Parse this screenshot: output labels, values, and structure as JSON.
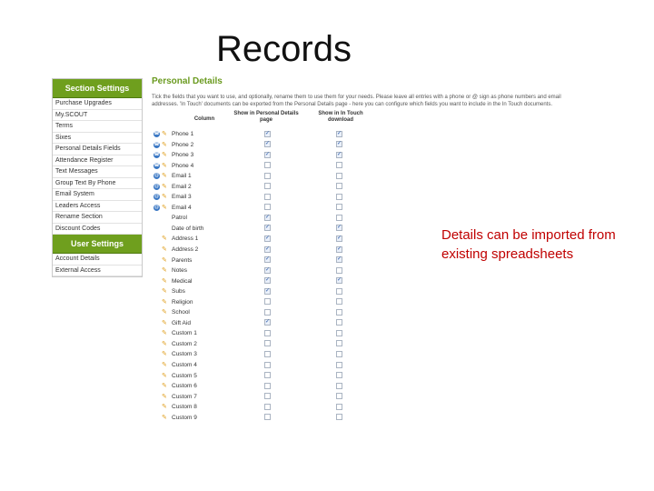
{
  "slide": {
    "title": "Records",
    "note": "Details can be imported from existing spreadsheets"
  },
  "colors": {
    "menu_header": "#6f9f1e",
    "panel_title": "#6a9a1f",
    "note_text": "#c00000",
    "phone_icon": "#3b78c4"
  },
  "sidebar": {
    "section_settings_heading": "Section Settings",
    "section_items": [
      {
        "label": "Purchase Upgrades"
      },
      {
        "label": "My.SCOUT"
      },
      {
        "label": "Terms"
      },
      {
        "label": "Sixes"
      },
      {
        "label": "Personal Details Fields"
      },
      {
        "label": "Attendance Register"
      },
      {
        "label": "Text Messages"
      },
      {
        "label": "Group Text By Phone"
      },
      {
        "label": "Email System"
      },
      {
        "label": "Leaders Access"
      },
      {
        "label": "Rename Section"
      },
      {
        "label": "Discount Codes"
      }
    ],
    "user_settings_heading": "User Settings",
    "user_items": [
      {
        "label": "Account Details"
      },
      {
        "label": "External Access"
      }
    ]
  },
  "main": {
    "title": "Personal Details",
    "intro": "Tick the fields that you want to use, and optionally, rename them to use them for your needs. Please leave all entries with a phone or @ sign as phone numbers and email addresses. 'In Touch' documents can be exported from the Personal Details page - here you can configure which fields you want to include in the In Touch documents.",
    "columns": {
      "column": "Column",
      "personal": "Show in Personal Details page",
      "intouch": "Show in In Touch download"
    },
    "rows": [
      {
        "label": "Phone 1",
        "icon": "phone-icon",
        "personal": true,
        "intouch": true
      },
      {
        "label": "Phone 2",
        "icon": "phone-icon",
        "personal": true,
        "intouch": true
      },
      {
        "label": "Phone 3",
        "icon": "phone-icon",
        "personal": true,
        "intouch": true
      },
      {
        "label": "Phone 4",
        "icon": "phone-icon",
        "personal": false,
        "intouch": false
      },
      {
        "label": "Email 1",
        "icon": "email-icon",
        "personal": false,
        "intouch": false
      },
      {
        "label": "Email 2",
        "icon": "email-icon",
        "personal": false,
        "intouch": false
      },
      {
        "label": "Email 3",
        "icon": "email-icon",
        "personal": false,
        "intouch": false
      },
      {
        "label": "Email 4",
        "icon": "email-icon",
        "personal": false,
        "intouch": false
      },
      {
        "label": "Patrol",
        "icon": "",
        "personal": true,
        "intouch": false
      },
      {
        "label": "Date of birth",
        "icon": "",
        "personal": true,
        "intouch": true
      },
      {
        "label": "Address 1",
        "icon": "",
        "personal": true,
        "intouch": true
      },
      {
        "label": "Address 2",
        "icon": "",
        "personal": true,
        "intouch": true
      },
      {
        "label": "Parents",
        "icon": "",
        "personal": true,
        "intouch": true
      },
      {
        "label": "Notes",
        "icon": "",
        "personal": true,
        "intouch": false
      },
      {
        "label": "Medical",
        "icon": "",
        "personal": true,
        "intouch": true
      },
      {
        "label": "Subs",
        "icon": "",
        "personal": true,
        "intouch": false
      },
      {
        "label": "Religion",
        "icon": "",
        "personal": false,
        "intouch": false
      },
      {
        "label": "School",
        "icon": "",
        "personal": false,
        "intouch": false
      },
      {
        "label": "Gift Aid",
        "icon": "",
        "personal": true,
        "intouch": false
      },
      {
        "label": "Custom 1",
        "icon": "",
        "personal": false,
        "intouch": false
      },
      {
        "label": "Custom 2",
        "icon": "",
        "personal": false,
        "intouch": false
      },
      {
        "label": "Custom 3",
        "icon": "",
        "personal": false,
        "intouch": false
      },
      {
        "label": "Custom 4",
        "icon": "",
        "personal": false,
        "intouch": false
      },
      {
        "label": "Custom 5",
        "icon": "",
        "personal": false,
        "intouch": false
      },
      {
        "label": "Custom 6",
        "icon": "",
        "personal": false,
        "intouch": false
      },
      {
        "label": "Custom 7",
        "icon": "",
        "personal": false,
        "intouch": false
      },
      {
        "label": "Custom 8",
        "icon": "",
        "personal": false,
        "intouch": false
      },
      {
        "label": "Custom 9",
        "icon": "",
        "personal": false,
        "intouch": false
      }
    ]
  }
}
